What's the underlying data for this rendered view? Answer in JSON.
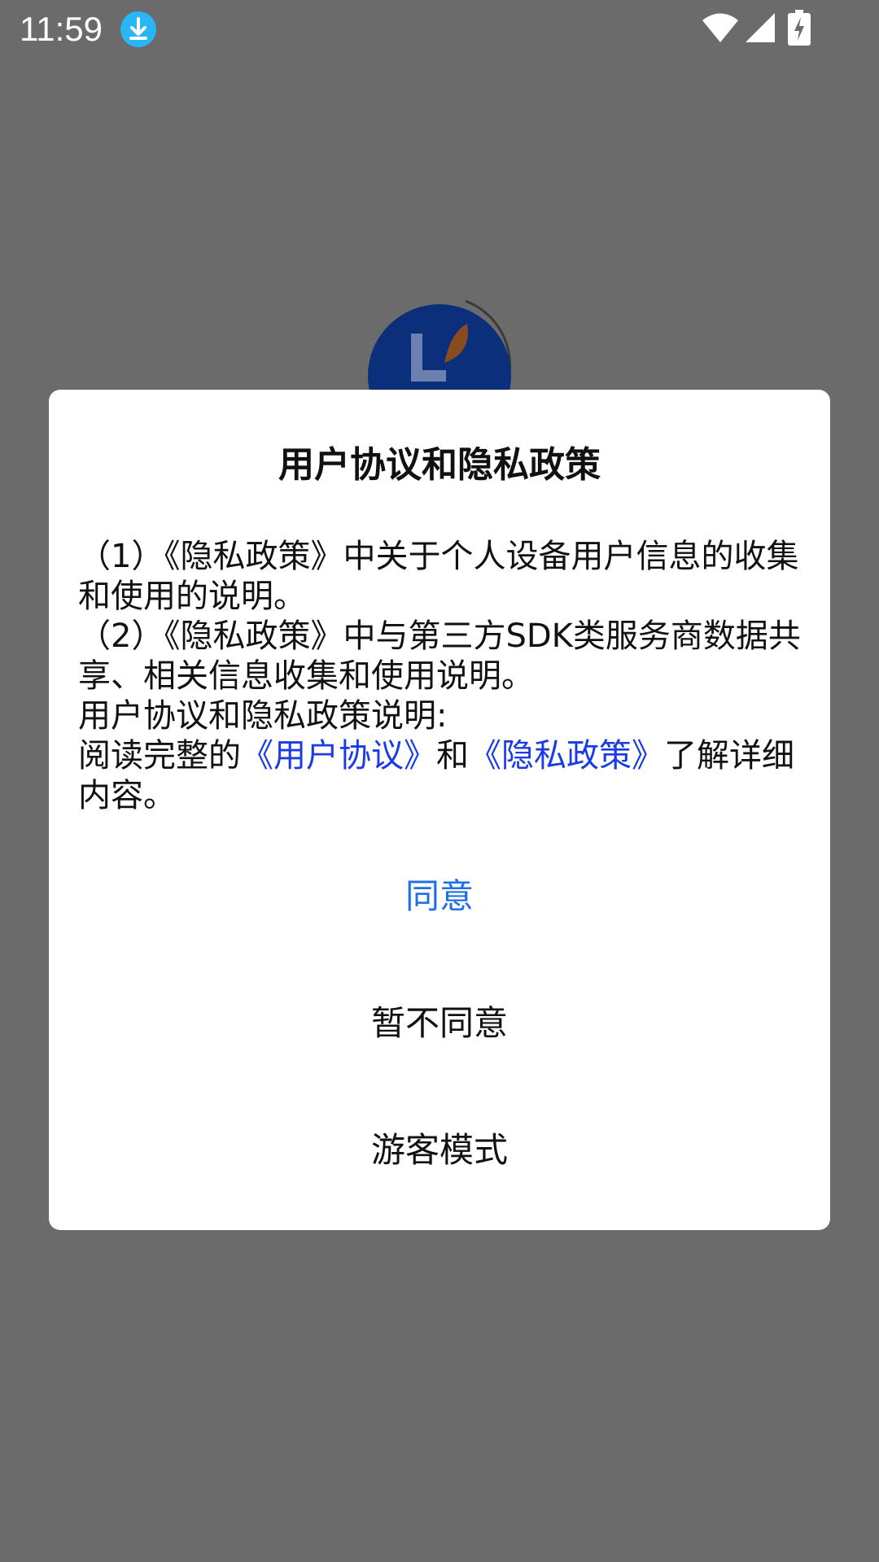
{
  "status_bar": {
    "time": "11:59",
    "icons": [
      "download-icon",
      "wifi-icon",
      "signal-icon",
      "battery-charging-icon"
    ]
  },
  "dialog": {
    "title": "用户协议和隐私政策",
    "body": {
      "line1": "（1）《隐私政策》中关于个人设备用户信息的收集和使用的说明。",
      "line2": "（2）《隐私政策》中与第三方SDK类服务商数据共享、相关信息收集和使用说明。",
      "line3": "用户协议和隐私政策说明:",
      "line4_prefix": "阅读完整的",
      "link_user_agreement": "《用户协议》",
      "line4_and": "和",
      "link_privacy_policy": "《隐私政策》",
      "line4_suffix": "了解详细内容。"
    },
    "buttons": {
      "agree": "同意",
      "disagree": "暂不同意",
      "guest": "游客模式"
    }
  },
  "colors": {
    "overlay": "#6b6b6b",
    "dialog_background": "#ffffff",
    "link": "#1a3be6",
    "agree_button": "#1f6fe5",
    "logo_primary": "#0b2f7a",
    "logo_accent": "#8a4b1e"
  }
}
